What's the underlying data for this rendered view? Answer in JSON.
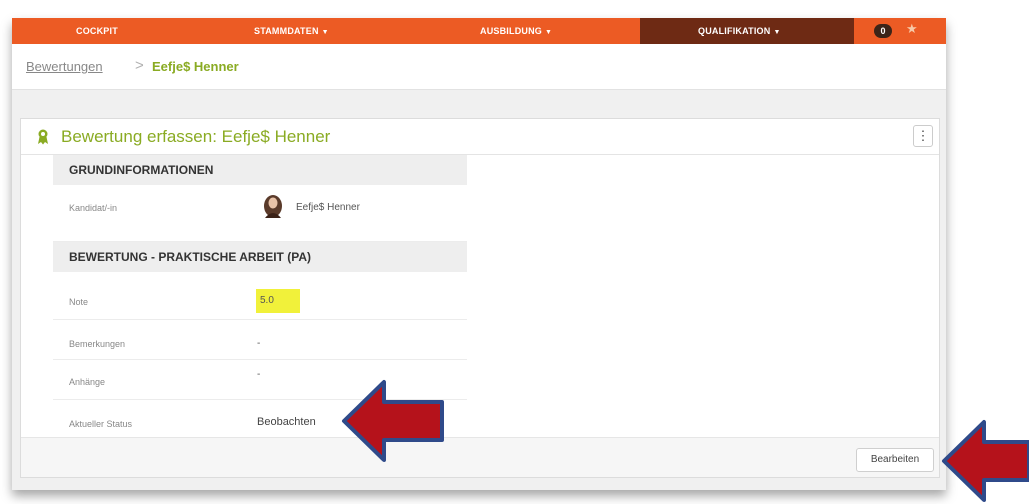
{
  "nav": {
    "items": [
      "COCKPIT",
      "STAMMDATEN",
      "AUSBILDUNG",
      "QUALIFIKATION"
    ],
    "caret": "▼",
    "badge_count": "0",
    "star_icon": "star-icon",
    "bar_color": "#ec5b24",
    "active_color": "#6e2a14"
  },
  "breadcrumb": {
    "first": "Bewertungen",
    "separator": ">",
    "current": "Eefje$ Henner"
  },
  "card": {
    "title": "Bewertung erfassen: Eefje$ Henner",
    "title_color": "#8aab23",
    "menu_icon": "⋮",
    "section1": {
      "heading": "GRUNDINFORMATIONEN",
      "rows": [
        {
          "label": "Kandidat/-in",
          "value": "Eefje$ Henner"
        }
      ]
    },
    "section2": {
      "heading": "BEWERTUNG - PRAKTISCHE ARBEIT (PA)",
      "rows": [
        {
          "label": "Note",
          "value": "5.0"
        },
        {
          "label": "Bemerkungen",
          "value": "-"
        },
        {
          "label": "Anhänge",
          "value": "-"
        },
        {
          "label": "Aktueller Status",
          "value": "Beobachten"
        }
      ]
    },
    "edit_button": "Bearbeiten"
  },
  "annotation_arrow_color": "#b5121b"
}
